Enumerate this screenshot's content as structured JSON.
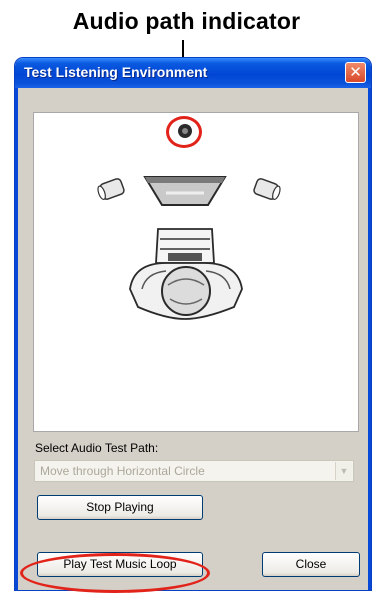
{
  "callout": {
    "label": "Audio path indicator",
    "accent_color": "#e2231a"
  },
  "window": {
    "title": "Test Listening Environment",
    "close_icon": "close-x-icon",
    "titlebar_color": "#0046d5"
  },
  "visualization": {
    "icons": [
      "audio-path-dot-icon",
      "front-left-speaker-icon",
      "center-speaker-icon",
      "front-right-speaker-icon",
      "listener-icon"
    ]
  },
  "path_select": {
    "label": "Select Audio Test Path:",
    "selected": "Move through Horizontal Circle"
  },
  "buttons": {
    "stop": "Stop Playing",
    "play_loop": "Play Test Music Loop",
    "close": "Close"
  }
}
